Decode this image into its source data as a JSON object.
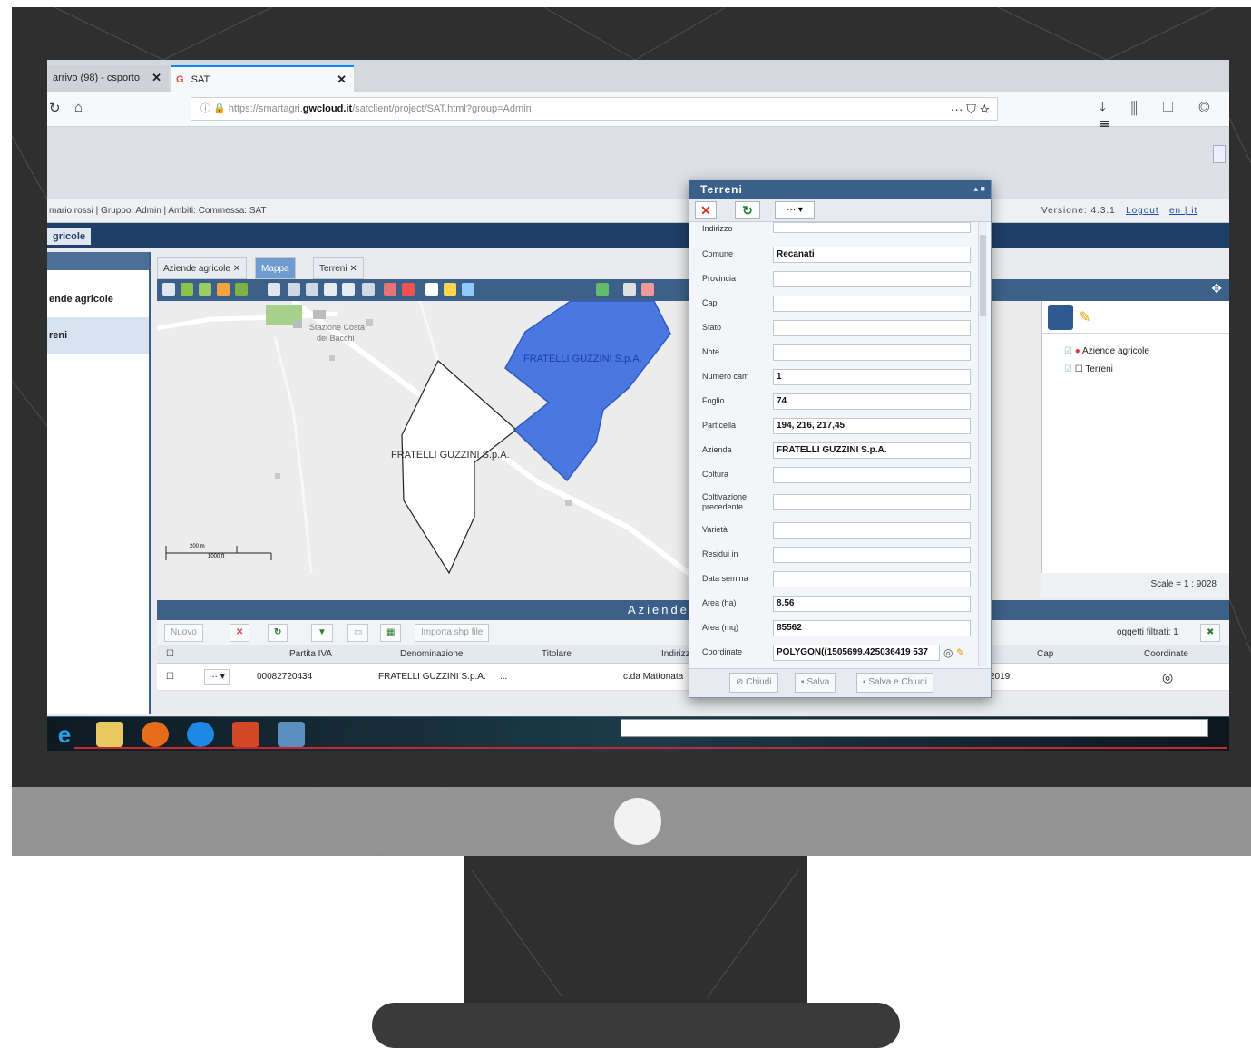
{
  "browser": {
    "tabs": [
      {
        "label": "arrivo (98) - csporto",
        "close": "✕"
      },
      {
        "label": "SAT",
        "close": "✕"
      }
    ],
    "url_prefix": "https://smartagri.",
    "url_domain": "gwcloud.it",
    "url_path": "/satclient/project/SAT.html?group=Admin",
    "url_actions": "···  ⛉  ☆",
    "right_icons": "⤓ ⫼ ◫ ◎ ☰"
  },
  "app": {
    "user_info": "mario.rossi | Gruppo: Admin | Ambiti: Commessa: SAT",
    "version": "Versione: 4.3.1",
    "logout": "Logout",
    "langs": "en | it",
    "title": "gricole",
    "left_menu": [
      {
        "label": "ende agricole",
        "selected": false
      },
      {
        "label": "reni",
        "selected": true
      }
    ],
    "main_tabs": [
      {
        "label": "Aziende agricole  ✕",
        "active": false
      },
      {
        "label": "Mappa",
        "active": true
      },
      {
        "label": "Terreni  ✕",
        "active": false
      }
    ],
    "map": {
      "parcel_labels": [
        "FRATELLI GUZZINI S.p.A.",
        "FRATELLI GUZZINI S.p.A."
      ],
      "place_label": "Stazione Costa",
      "place_label2": "dei Bacchi",
      "scale_top": "200 m",
      "scale_bottom": "1000 ft"
    },
    "layers": [
      "Aziende agricole",
      "Terreni"
    ],
    "scale": "Scale = 1 : 9028",
    "grid": {
      "title": "Aziende agricole",
      "buttons": [
        "Nuovo",
        "Importa shp file"
      ],
      "filter_text": "oggetti filtrati: 1",
      "headers": [
        "Partita IVA",
        "Denominazione",
        "Titolare",
        "Indirizzo",
        "Cap",
        "Coordinate"
      ],
      "row": {
        "menu": "···  ▾",
        "partita_iva": "00082720434",
        "denominazione": "FRATELLI GUZZINI S.p.A.",
        "titolare": "...",
        "indirizzo": "c.da Mattonata",
        "date": "2019",
        "coord_icon": "◎"
      }
    }
  },
  "dialog": {
    "title": "Terreni",
    "toolbar_more": "···  ▾",
    "fields": [
      {
        "label": "Indirizzo",
        "value": ""
      },
      {
        "label": "Comune",
        "value": "Recanati"
      },
      {
        "label": "Provincia",
        "value": ""
      },
      {
        "label": "Cap",
        "value": ""
      },
      {
        "label": "Stato",
        "value": ""
      },
      {
        "label": "Note",
        "value": ""
      },
      {
        "label": "Numero cam",
        "value": "1"
      },
      {
        "label": "Foglio",
        "value": "74"
      },
      {
        "label": "Particella",
        "value": "194, 216, 217,45"
      },
      {
        "label": "Azienda",
        "value": "FRATELLI GUZZINI S.p.A."
      },
      {
        "label": "Coltura",
        "value": ""
      },
      {
        "label": "Coltivazione precedente",
        "value": ""
      },
      {
        "label": "Varietà",
        "value": ""
      },
      {
        "label": "Residui in",
        "value": ""
      },
      {
        "label": "Data semina",
        "value": ""
      },
      {
        "label": "Area (ha)",
        "value": "8.56"
      },
      {
        "label": "Area (mq)",
        "value": "85562"
      },
      {
        "label": "Coordinate",
        "value": "POLYGON((1505699.425036419 537"
      }
    ],
    "footer": [
      "Chiudi",
      "Salva",
      "Salva e Chiudi"
    ]
  },
  "colors": {
    "parcel_selected": "#3d6fe0",
    "header_blue": "#3c6089",
    "accent": "#0a84ff"
  }
}
